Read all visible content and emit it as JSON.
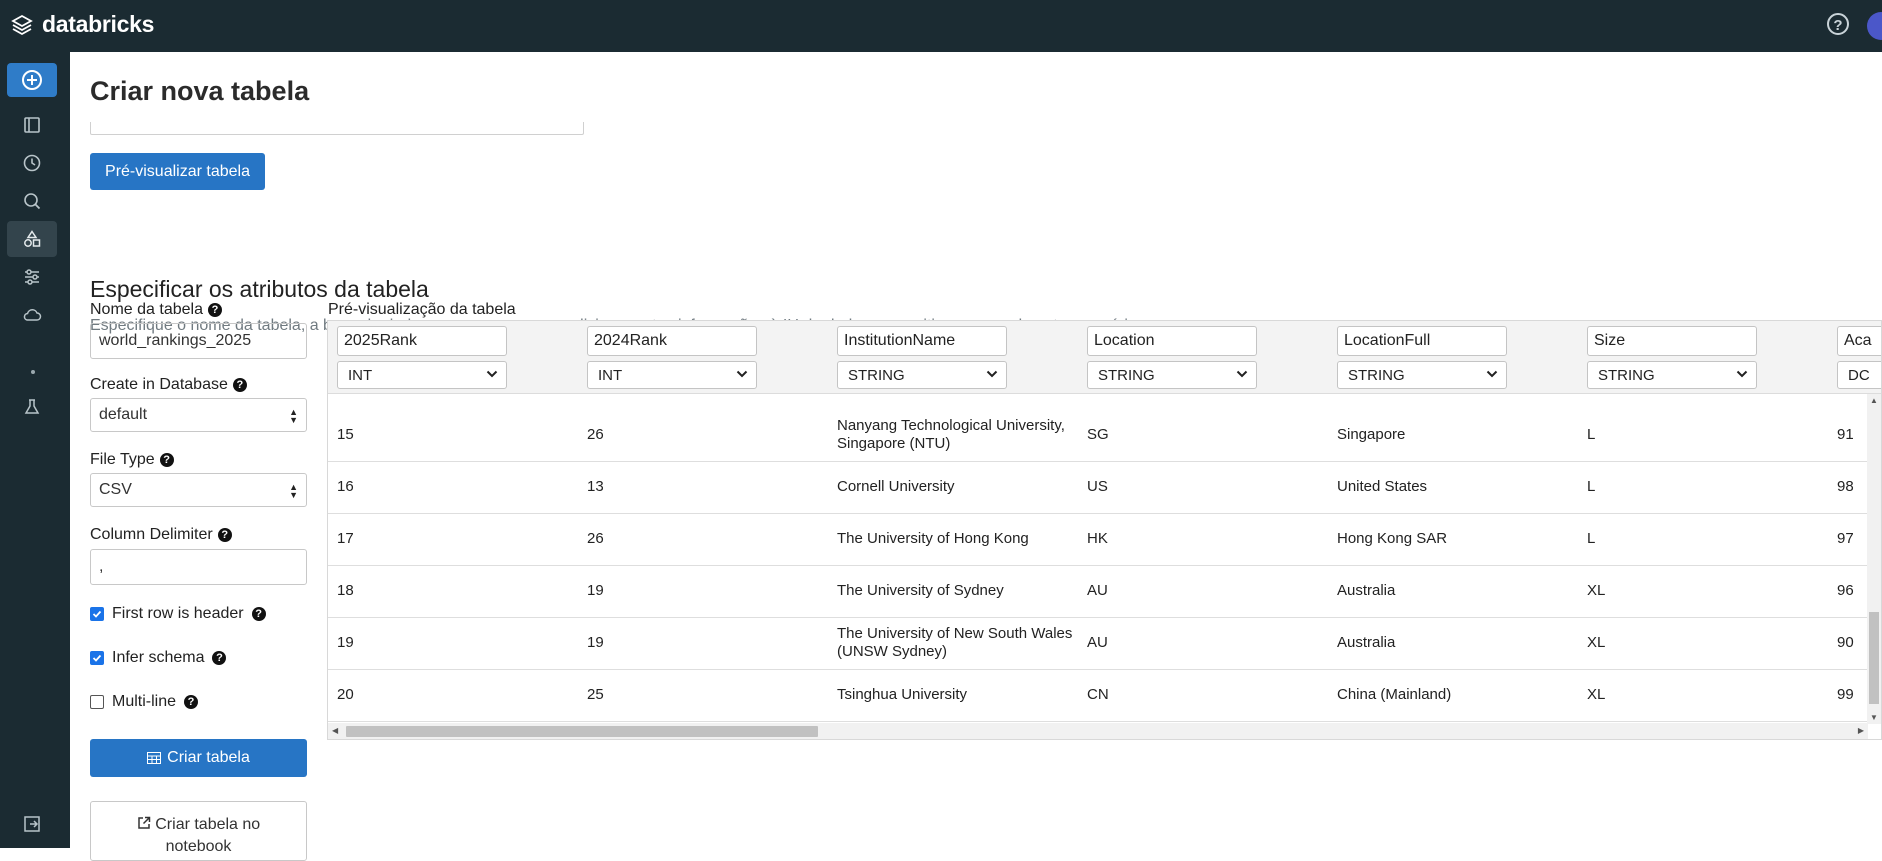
{
  "brand": {
    "name": "databricks"
  },
  "header": {
    "help_icon": "question-circle-icon"
  },
  "sidebar": {
    "create_icon": "plus-circle-icon",
    "icons": [
      "workspace-icon",
      "clock-icon",
      "search-icon",
      "data-shapes-icon",
      "workflows-icon",
      "cloud-icon",
      "flask-icon",
      "sidebar-collapse-icon"
    ]
  },
  "page": {
    "title": "Criar nova tabela",
    "preview_button": "Pré-visualizar tabela",
    "section_title": "Especificar os atributos da tabela",
    "section_desc": "Especifique o nome da tabela, a base de dados e o esquema para adicionar estas informações à IU de dados e permitir o acesso de outros usuários"
  },
  "form": {
    "table_name_label": "Nome da tabela",
    "table_name_value": "world_rankings_2025",
    "database_label": "Create in Database",
    "database_value": "default",
    "file_type_label": "File Type",
    "file_type_value": "CSV",
    "delimiter_label": "Column Delimiter",
    "delimiter_value": ",",
    "first_row_header_label": "First row is header",
    "first_row_header_checked": true,
    "infer_schema_label": "Infer schema",
    "infer_schema_checked": true,
    "multiline_label": "Multi-line",
    "multiline_checked": false,
    "create_button": "Criar tabela",
    "create_notebook_button_line1": "Criar tabela no",
    "create_notebook_button_line2": "notebook",
    "help_glyph": "?"
  },
  "preview": {
    "label": "Pré-visualização da tabela",
    "columns": [
      {
        "name": "2025Rank",
        "type": "INT"
      },
      {
        "name": "2024Rank",
        "type": "INT"
      },
      {
        "name": "InstitutionName",
        "type": "STRING"
      },
      {
        "name": "Location",
        "type": "STRING"
      },
      {
        "name": "LocationFull",
        "type": "STRING"
      },
      {
        "name": "Size",
        "type": "STRING"
      },
      {
        "name": "Aca",
        "type": "DC"
      }
    ],
    "rows": [
      [
        "15",
        "26",
        "Nanyang Technological University, Singapore (NTU)",
        "SG",
        "Singapore",
        "L",
        "91"
      ],
      [
        "16",
        "13",
        "Cornell University",
        "US",
        "United States",
        "L",
        "98"
      ],
      [
        "17",
        "26",
        "The University of Hong Kong",
        "HK",
        "Hong Kong SAR",
        "L",
        "97"
      ],
      [
        "18",
        "19",
        "The University of Sydney",
        "AU",
        "Australia",
        "XL",
        "96"
      ],
      [
        "19",
        "19",
        "The University of New South Wales (UNSW Sydney)",
        "AU",
        "Australia",
        "XL",
        "90"
      ],
      [
        "20",
        "25",
        "Tsinghua University",
        "CN",
        "China (Mainland)",
        "XL",
        "99"
      ]
    ]
  },
  "colors": {
    "topbar": "#1b2b32",
    "primary": "#2775c5",
    "checkbox": "#1a73e8"
  }
}
